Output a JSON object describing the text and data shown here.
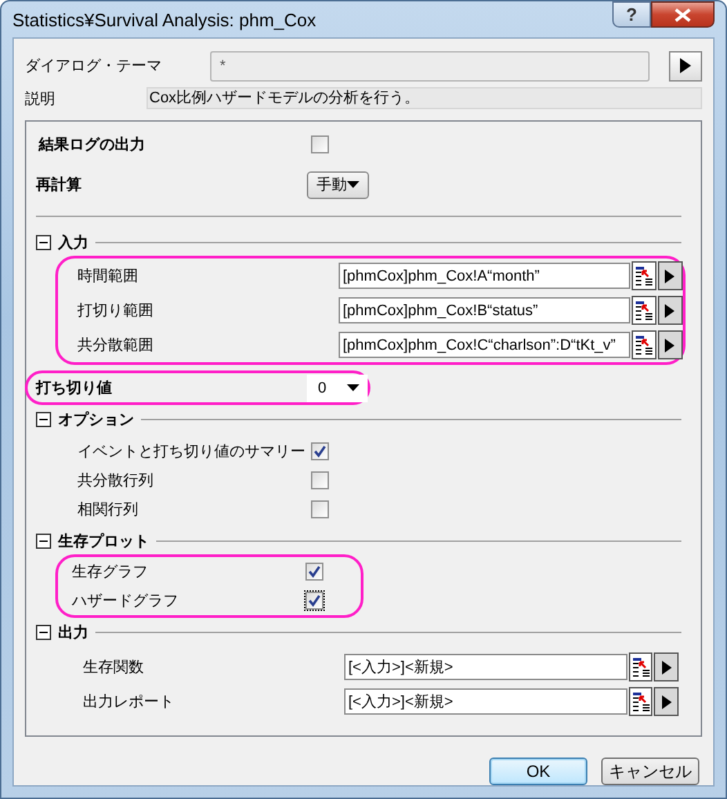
{
  "window": {
    "title": "Statistics¥Survival Analysis: phm_Cox",
    "help": "?"
  },
  "theme": {
    "label": "ダイアログ・テーマ",
    "value": "*"
  },
  "description": {
    "label": "説明",
    "value": "Cox比例ハザードモデルの分析を行う。"
  },
  "items": [
    {
      "kind": "checkbox",
      "label": "結果ログの出力",
      "checked": false,
      "highlighted": false
    },
    {
      "kind": "dropdown",
      "label": "再計算",
      "value": "手動",
      "highlighted": false
    },
    {
      "kind": "divider"
    },
    {
      "kind": "section",
      "label": "入力",
      "expanded": true,
      "highlighted": true,
      "children": [
        {
          "kind": "range",
          "label": "時間範囲",
          "value": "[phmCox]phm_Cox!A“month”"
        },
        {
          "kind": "range",
          "label": "打切り範囲",
          "value": "[phmCox]phm_Cox!B“status”"
        },
        {
          "kind": "range",
          "label": "共分散範囲",
          "value": "[phmCox]phm_Cox!C“charlson”:D“tKt_v”"
        }
      ]
    },
    {
      "kind": "combobox",
      "label": "打ち切り値",
      "value": "0",
      "highlighted": true
    },
    {
      "kind": "section",
      "label": "オプション",
      "expanded": true,
      "highlighted": false,
      "children": [
        {
          "kind": "checkbox",
          "label": "イベントと打ち切り値のサマリー",
          "checked": true,
          "focused": false
        },
        {
          "kind": "checkbox",
          "label": "共分散行列",
          "checked": false,
          "focused": false
        },
        {
          "kind": "checkbox",
          "label": "相関行列",
          "checked": false,
          "focused": false
        }
      ]
    },
    {
      "kind": "section",
      "label": "生存プロット",
      "expanded": true,
      "highlighted": true,
      "children": [
        {
          "kind": "checkbox",
          "label": "生存グラフ",
          "checked": true,
          "focused": false
        },
        {
          "kind": "checkbox",
          "label": "ハザードグラフ",
          "checked": true,
          "focused": true
        }
      ]
    },
    {
      "kind": "section",
      "label": "出力",
      "expanded": true,
      "highlighted": false,
      "children": [
        {
          "kind": "range",
          "label": "生存関数",
          "value": "[<入力>]<新規>"
        },
        {
          "kind": "range",
          "label": "出力レポート",
          "value": "[<入力>]<新規>"
        }
      ]
    }
  ],
  "buttons": [
    {
      "label": "OK",
      "default": true
    },
    {
      "label": "キャンセル",
      "default": false
    }
  ]
}
